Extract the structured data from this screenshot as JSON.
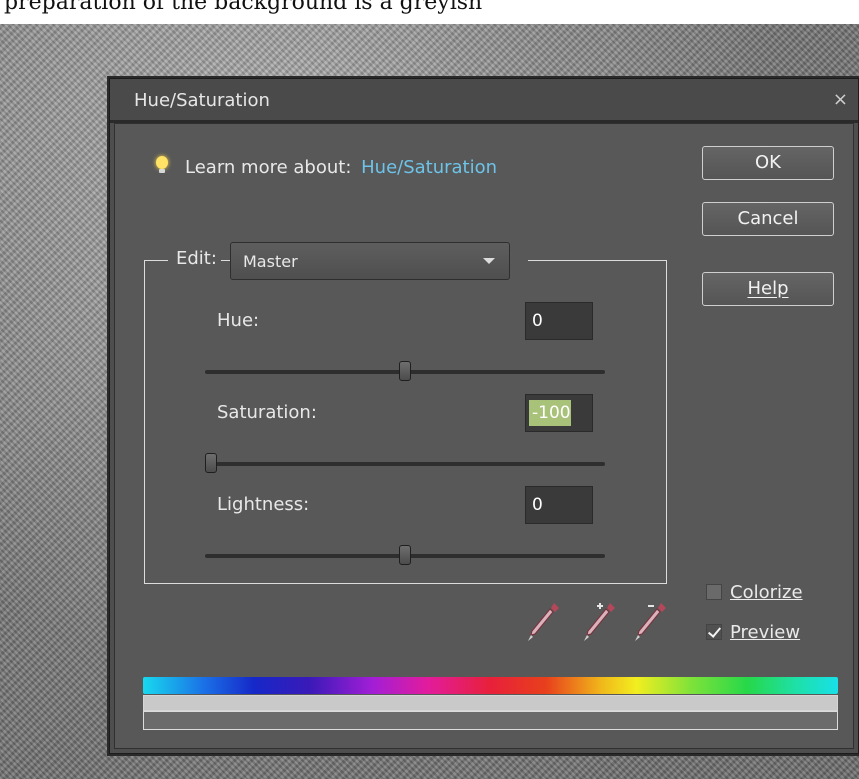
{
  "page_caption": "preparation of the background is a greyish",
  "dialog": {
    "title": "Hue/Saturation",
    "close_glyph": "×",
    "learn_more_label": "Learn more about:",
    "learn_more_link": "Hue/Saturation",
    "buttons": {
      "ok": "OK",
      "cancel": "Cancel",
      "help": "Help"
    },
    "edit_label": "Edit:",
    "edit_value": "Master",
    "hue": {
      "label": "Hue:",
      "value": "0",
      "slider_fraction": 0.5
    },
    "saturation": {
      "label": "Saturation:",
      "value": "-100",
      "slider_fraction": 0.0
    },
    "lightness": {
      "label": "Lightness:",
      "value": "0",
      "slider_fraction": 0.5
    },
    "colorize": {
      "label": "Colorize",
      "checked": false
    },
    "preview": {
      "label": "Preview",
      "checked": true
    }
  },
  "colors": {
    "link": "#6ec3e8",
    "highlight": "#a9c27a",
    "eyedropper": "#b5475a"
  },
  "icons": [
    "lightbulb-icon",
    "close-icon",
    "chevron-down-icon",
    "eyedropper-icon",
    "eyedropper-plus-icon",
    "eyedropper-minus-icon",
    "checkmark-icon"
  ]
}
